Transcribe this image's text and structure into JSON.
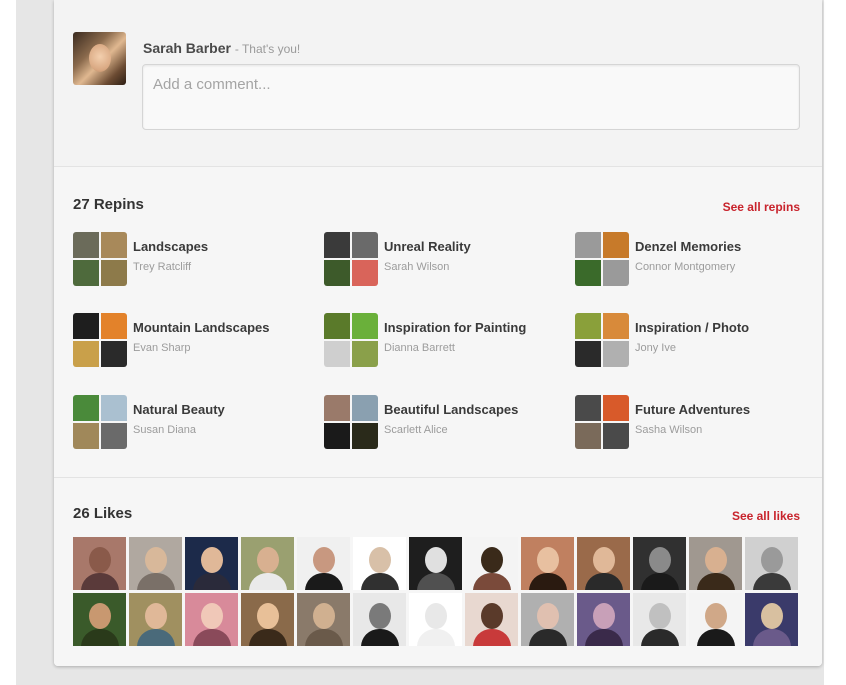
{
  "comment": {
    "user_name": "Sarah Barber",
    "you_label": "- That's you!",
    "placeholder": "Add a comment..."
  },
  "repins": {
    "title": "27 Repins",
    "see_all": "See all repins",
    "boards": [
      {
        "name": "Landscapes",
        "owner": "Trey Ratcliff",
        "colors": [
          "#6b6b5a",
          "#a8895a",
          "#4e6a3c",
          "#8d7a4a"
        ]
      },
      {
        "name": "Unreal Reality",
        "owner": "Sarah Wilson",
        "colors": [
          "#3a3a3a",
          "#6a6a6a",
          "#3d5a2a",
          "#d9645a"
        ]
      },
      {
        "name": "Denzel Memories",
        "owner": "Connor Montgomery",
        "colors": [
          "#9a9a9a",
          "#c77a2a",
          "#3a6a2a",
          "#9a9a9a"
        ]
      },
      {
        "name": "Mountain Landscapes",
        "owner": "Evan Sharp",
        "colors": [
          "#1e1e1e",
          "#e3822a",
          "#c9a04a",
          "#2a2a2a"
        ]
      },
      {
        "name": "Inspiration for Painting",
        "owner": "Dianna Barrett",
        "colors": [
          "#5a7a2a",
          "#6ab03a",
          "#cfcfcf",
          "#8aa04a"
        ]
      },
      {
        "name": "Inspiration / Photo",
        "owner": "Jony Ive",
        "colors": [
          "#8aa03a",
          "#d88a3a",
          "#2a2a2a",
          "#b0b0b0"
        ]
      },
      {
        "name": "Natural Beauty",
        "owner": "Susan Diana",
        "colors": [
          "#4a8a3a",
          "#aac0d0",
          "#a0885a",
          "#6a6a6a"
        ]
      },
      {
        "name": "Beautiful Landscapes",
        "owner": "Scarlett Alice",
        "colors": [
          "#9a7a6a",
          "#8aa0b0",
          "#1a1a1a",
          "#2a2a1a"
        ]
      },
      {
        "name": "Future Adventures",
        "owner": "Sasha Wilson",
        "colors": [
          "#4a4a4a",
          "#d85a2a",
          "#7a6a5a",
          "#4a4a4a"
        ]
      }
    ]
  },
  "likes": {
    "title": "26 Likes",
    "see_all": "See all likes",
    "people": [
      {
        "bg": "#a8786a",
        "head": "#8a5a4a",
        "body": "#5a3a3a"
      },
      {
        "bg": "#b0a8a0",
        "head": "#d8b89a",
        "body": "#7a7068"
      },
      {
        "bg": "#1c2a4a",
        "head": "#e0b898",
        "body": "#2a2a3a"
      },
      {
        "bg": "#9aa070",
        "head": "#d8b090",
        "body": "#eaeaea"
      },
      {
        "bg": "#f0f0f0",
        "head": "#c89880",
        "body": "#1a1a1a"
      },
      {
        "bg": "#ffffff",
        "head": "#d8c0a8",
        "body": "#303030"
      },
      {
        "bg": "#1e1e1e",
        "head": "#e0e0e0",
        "body": "#505050"
      },
      {
        "bg": "#f4f4f4",
        "head": "#3a2a1a",
        "body": "#7a4a3a"
      },
      {
        "bg": "#c08060",
        "head": "#e8c0a0",
        "body": "#2a1a10"
      },
      {
        "bg": "#9a6a4a",
        "head": "#e0b898",
        "body": "#2a2a2a"
      },
      {
        "bg": "#303030",
        "head": "#8a8a8a",
        "body": "#1a1a1a"
      },
      {
        "bg": "#a09890",
        "head": "#d8b090",
        "body": "#3a2a1a"
      },
      {
        "bg": "#d0d0d0",
        "head": "#9a9a9a",
        "body": "#3a3a3a"
      },
      {
        "bg": "#3a5a2a",
        "head": "#c89870",
        "body": "#2a3a1a"
      },
      {
        "bg": "#a09060",
        "head": "#e0b898",
        "body": "#4a6a7a"
      },
      {
        "bg": "#d88a9a",
        "head": "#f0c8b8",
        "body": "#8a4a5a"
      },
      {
        "bg": "#8a6a4a",
        "head": "#e8c098",
        "body": "#3a2a1a"
      },
      {
        "bg": "#8a7a6a",
        "head": "#d0b090",
        "body": "#6a5a4a"
      },
      {
        "bg": "#e8e8e8",
        "head": "#7a7a7a",
        "body": "#1a1a1a"
      },
      {
        "bg": "#ffffff",
        "head": "#e8e8e8",
        "body": "#f0f0f0"
      },
      {
        "bg": "#e8d8d0",
        "head": "#5a3a2a",
        "body": "#c83a3a"
      },
      {
        "bg": "#b0b0b0",
        "head": "#e0c0b0",
        "body": "#2a2a2a"
      },
      {
        "bg": "#6a5a8a",
        "head": "#c8a0b8",
        "body": "#3a2a4a"
      },
      {
        "bg": "#e8e8e8",
        "head": "#c0c0c0",
        "body": "#2a2a2a"
      },
      {
        "bg": "#f4f4f4",
        "head": "#d0a888",
        "body": "#1a1a1a"
      },
      {
        "bg": "#3a3a6a",
        "head": "#d8c0a0",
        "body": "#6a5a8a"
      }
    ]
  }
}
